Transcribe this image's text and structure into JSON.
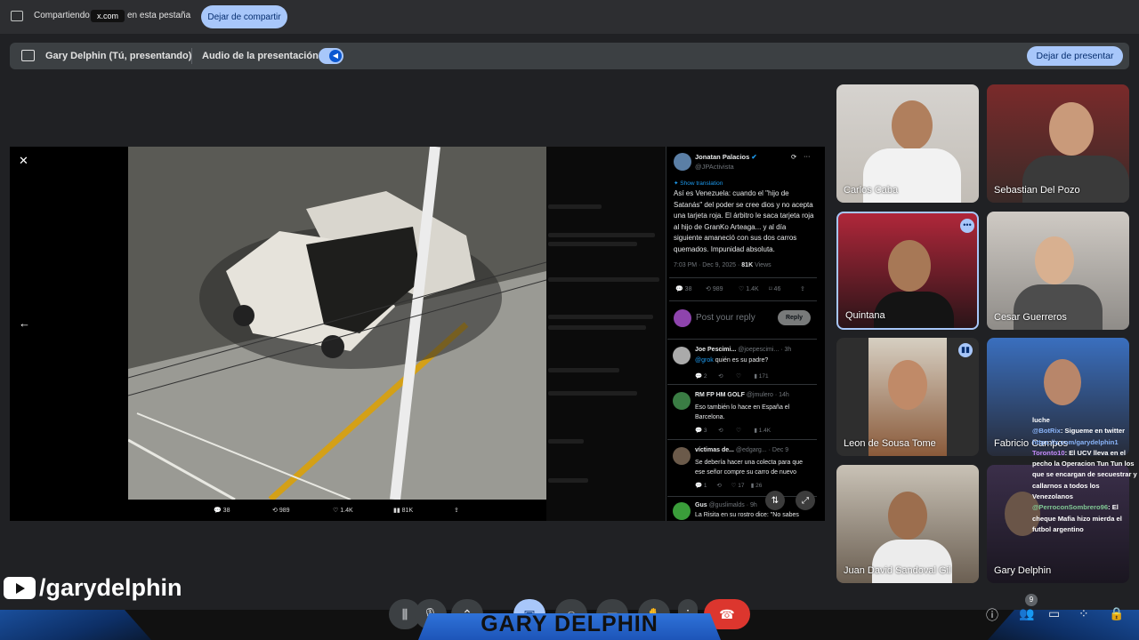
{
  "share_bar": {
    "sharing_label": "Compartiendo",
    "domain": "x.com",
    "tab_label": "en esta pestaña",
    "stop_sharing": "Dejar de compartir"
  },
  "present_bar": {
    "presenter": "Gary Delphin (Tú, presentando)",
    "audio_label": "Audio de la presentación",
    "stop_presenting": "Dejar de presentar"
  },
  "tweet": {
    "author": "Jonatan Palacios",
    "handle": "@JPActivista",
    "show_translation": "Show translation",
    "text": "Así es Venezuela: cuando el \"hijo de Satanás\" del poder se cree dios y no acepta una tarjeta roja. El árbitro le saca tarjeta roja al hijo de GranKo Arteaga... y al día siguiente amaneció con sus dos carros quemados. Impunidad absoluta.",
    "time": "7:03 PM · Dec 9, 2025 ·",
    "views": "81K",
    "views_label": "Views",
    "replies": "38",
    "retweets": "989",
    "likes": "1.4K",
    "bookmarks": "46",
    "reply_placeholder": "Post your reply",
    "reply_button": "Reply"
  },
  "photo_actions": {
    "replies": "38",
    "retweets": "989",
    "likes": "1.4K",
    "views": "81K"
  },
  "replies": [
    {
      "name": "Joe Pescimi...",
      "handle": "@joepescimi...",
      "time": "· 3h",
      "mention": "@grok",
      "text": "quién es su padre?",
      "c": "2",
      "l": "",
      "v": "171"
    },
    {
      "name": "RM FP HM GOLF",
      "handle": "@jmulero",
      "time": "· 14h",
      "mention": "",
      "text": "Eso también lo hace en España el Barcelona.",
      "c": "3",
      "l": "",
      "v": "1.4K"
    },
    {
      "name": "víctimas de...",
      "handle": "@edgarg...",
      "time": "· Dec 9",
      "mention": "",
      "text": "Se debería hacer una colecta para que ese señor compre su carro de nuevo",
      "c": "1",
      "l": "17",
      "v": "26"
    },
    {
      "name": "Gus",
      "handle": "@guslimalds · 9h",
      "time": "",
      "mention": "",
      "text": "La Risita en su rostro dice: \"No sabes",
      "c": "",
      "l": "",
      "v": ""
    }
  ],
  "participants": [
    {
      "name": "Carlos Caba"
    },
    {
      "name": "Sebastian Del Pozo"
    },
    {
      "name": "Quintana"
    },
    {
      "name": "Cesar Guerreros"
    },
    {
      "name": "Leon de Sousa Tome"
    },
    {
      "name": "Fabricio Campos"
    },
    {
      "name": "Juan David Sandoval Gil"
    },
    {
      "name": "Gary Delphin"
    }
  ],
  "chat": [
    {
      "user": "",
      "text": "luche"
    },
    {
      "user": "@BotRix",
      "text": ": Sigueme en twitter"
    },
    {
      "user": "",
      "text": "https://x.com/garydelphin1"
    },
    {
      "user": "Toronto10",
      "text": ": El UCV lleva en el pecho la Operacion Tun Tun los que se encargan de secuestrar y callarnos a todos los Venezolanos"
    },
    {
      "user": "@PerroconSombrero96",
      "text": ": El cheque Mafia hizo mierda el futbol argentino"
    }
  ],
  "overlay": {
    "handle": "/garydelphin",
    "brand": "GARY DELPHIN"
  },
  "controls": {
    "people_count": "9"
  },
  "colors": {
    "accent": "#a8c7fa",
    "end_call": "#dc362e",
    "brand_blue": "#1d55b8"
  }
}
